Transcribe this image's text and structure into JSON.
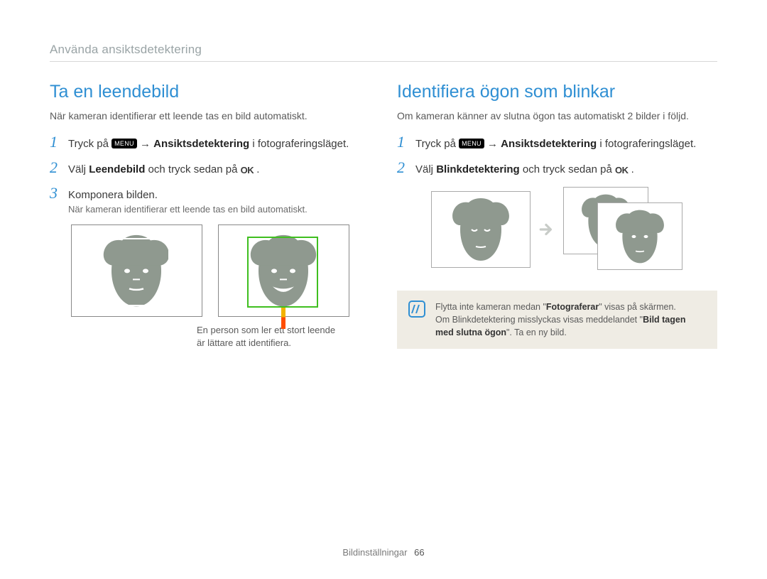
{
  "breadcrumb": "Använda ansiktsdetektering",
  "left": {
    "heading": "Ta en leendebild",
    "intro": "När kameran identifierar ett leende tas en bild automatiskt.",
    "step1_pre": "Tryck på ",
    "step1_menu": "MENU",
    "step1_arrow": " → ",
    "step1_bold": "Ansiktsdetektering",
    "step1_post": " i fotograferingsläget.",
    "step2_pre": "Välj ",
    "step2_bold": "Leendebild",
    "step2_mid": " och tryck sedan på ",
    "step2_ok": "OK",
    "step2_post": ".",
    "step3": "Komponera bilden.",
    "step3_sub": "När kameran identifierar ett leende tas en bild automatiskt.",
    "caption": "En person som ler ett stort leende är lättare att identifiera."
  },
  "right": {
    "heading": "Identifiera ögon som blinkar",
    "intro": "Om kameran känner av slutna ögon tas automatiskt 2 bilder i följd.",
    "step1_pre": "Tryck på ",
    "step1_menu": "MENU",
    "step1_arrow": " → ",
    "step1_bold": "Ansiktsdetektering",
    "step1_post": " i fotograferingsläget.",
    "step2_pre": "Välj ",
    "step2_bold": "Blinkdetektering",
    "step2_mid": " och tryck sedan på ",
    "step2_ok": "OK",
    "step2_post": ".",
    "note_l1_pre": "Flytta inte kameran medan \"",
    "note_l1_bold": "Fotograferar",
    "note_l1_post": "\" visas på skärmen.",
    "note_l2_pre": "Om Blinkdetektering misslyckas visas meddelandet \"",
    "note_l2_bold": "Bild tagen med slutna ögon",
    "note_l2_post": "\". Ta en ny bild."
  },
  "footer_label": "Bildinställningar",
  "footer_page": "66"
}
